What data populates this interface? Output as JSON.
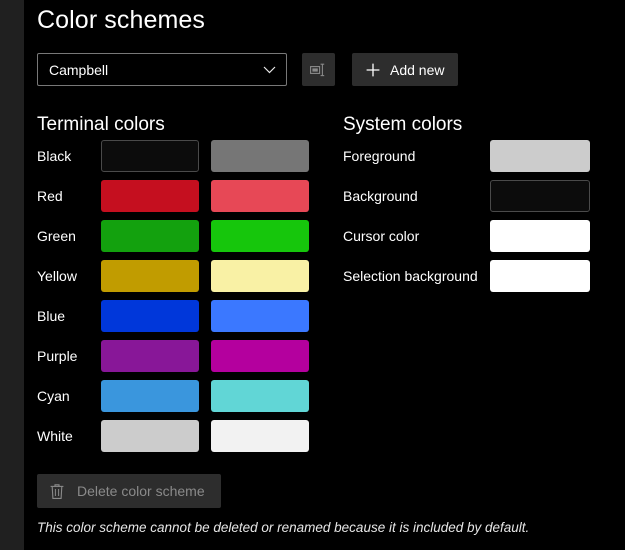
{
  "page": {
    "title": "Color schemes",
    "footer_note": "This color scheme cannot be deleted or renamed because it is included by default."
  },
  "scheme_selector": {
    "selected": "Campbell",
    "chevron_icon": "chevron-down-icon",
    "rename_icon": "rename-icon",
    "add_new_label": "Add new",
    "add_new_icon": "plus-icon"
  },
  "terminal_colors": {
    "heading": "Terminal colors",
    "rows": [
      {
        "label": "Black",
        "normal": "#0c0c0c",
        "bright": "#767676",
        "normal_outlined": true,
        "bright_outlined": false
      },
      {
        "label": "Red",
        "normal": "#c50f1f",
        "bright": "#e74856",
        "normal_outlined": false,
        "bright_outlined": false
      },
      {
        "label": "Green",
        "normal": "#13a10e",
        "bright": "#16c60c",
        "normal_outlined": false,
        "bright_outlined": false
      },
      {
        "label": "Yellow",
        "normal": "#c19c00",
        "bright": "#f9f1a5",
        "normal_outlined": false,
        "bright_outlined": false
      },
      {
        "label": "Blue",
        "normal": "#0037da",
        "bright": "#3b78ff",
        "normal_outlined": false,
        "bright_outlined": false
      },
      {
        "label": "Purple",
        "normal": "#881798",
        "bright": "#b4009e",
        "normal_outlined": false,
        "bright_outlined": false
      },
      {
        "label": "Cyan",
        "normal": "#3a96dd",
        "bright": "#61d6d6",
        "normal_outlined": false,
        "bright_outlined": false
      },
      {
        "label": "White",
        "normal": "#cccccc",
        "bright": "#f2f2f2",
        "normal_outlined": false,
        "bright_outlined": false
      }
    ]
  },
  "system_colors": {
    "heading": "System colors",
    "rows": [
      {
        "label": "Foreground",
        "color": "#cccccc",
        "outlined": false
      },
      {
        "label": "Background",
        "color": "#0c0c0c",
        "outlined": true
      },
      {
        "label": "Cursor color",
        "color": "#ffffff",
        "outlined": false
      },
      {
        "label": "Selection background",
        "color": "#ffffff",
        "outlined": false
      }
    ]
  },
  "delete": {
    "label": "Delete color scheme",
    "icon": "trash-icon",
    "disabled": true
  }
}
